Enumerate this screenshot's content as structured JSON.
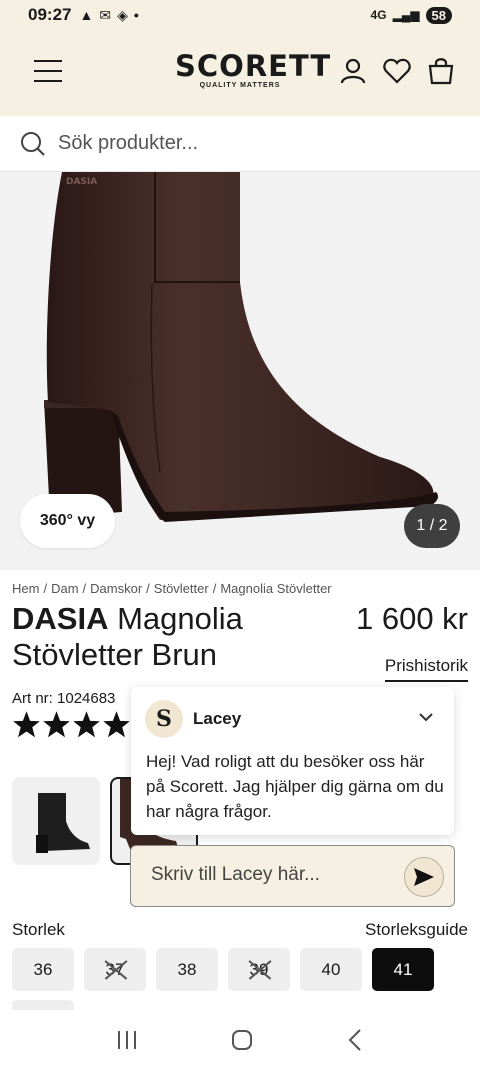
{
  "status_bar": {
    "time": "09:27",
    "network": "4G",
    "battery": "58"
  },
  "header": {
    "logo_name": "SCORETT",
    "logo_tagline": "QUALITY MATTERS"
  },
  "search": {
    "placeholder": "Sök produkter..."
  },
  "gallery": {
    "view_360_label": "360° vy",
    "counter": "1 / 2"
  },
  "breadcrumb": [
    "Hem",
    "Dam",
    "Damskor",
    "Stövletter",
    "Magnolia Stövletter"
  ],
  "product": {
    "brand": "DASIA",
    "name": "Magnolia Stövletter Brun",
    "price": "1 600 kr",
    "price_history_label": "Prishistorik",
    "art_nr": "Art nr: 1024683",
    "rating": 5
  },
  "sizes": {
    "label": "Storlek",
    "guide_label": "Storleksguide",
    "items": [
      {
        "label": "36",
        "available": true,
        "selected": false
      },
      {
        "label": "37",
        "available": false,
        "selected": false
      },
      {
        "label": "38",
        "available": true,
        "selected": false
      },
      {
        "label": "39",
        "available": false,
        "selected": false
      },
      {
        "label": "40",
        "available": true,
        "selected": false
      },
      {
        "label": "41",
        "available": true,
        "selected": true
      }
    ]
  },
  "chat": {
    "agent_initial": "S",
    "agent_name": "Lacey",
    "message": "Hej! Vad roligt att du besöker oss här på Scorett. Jag hjälper dig gärna om du har några frågor.",
    "input_placeholder": "Skriv till Lacey här..."
  },
  "colors": {
    "header_bg": "#f6f0e2",
    "boot_brown": "#3d2723",
    "selected_size": "#0d0d0d"
  }
}
